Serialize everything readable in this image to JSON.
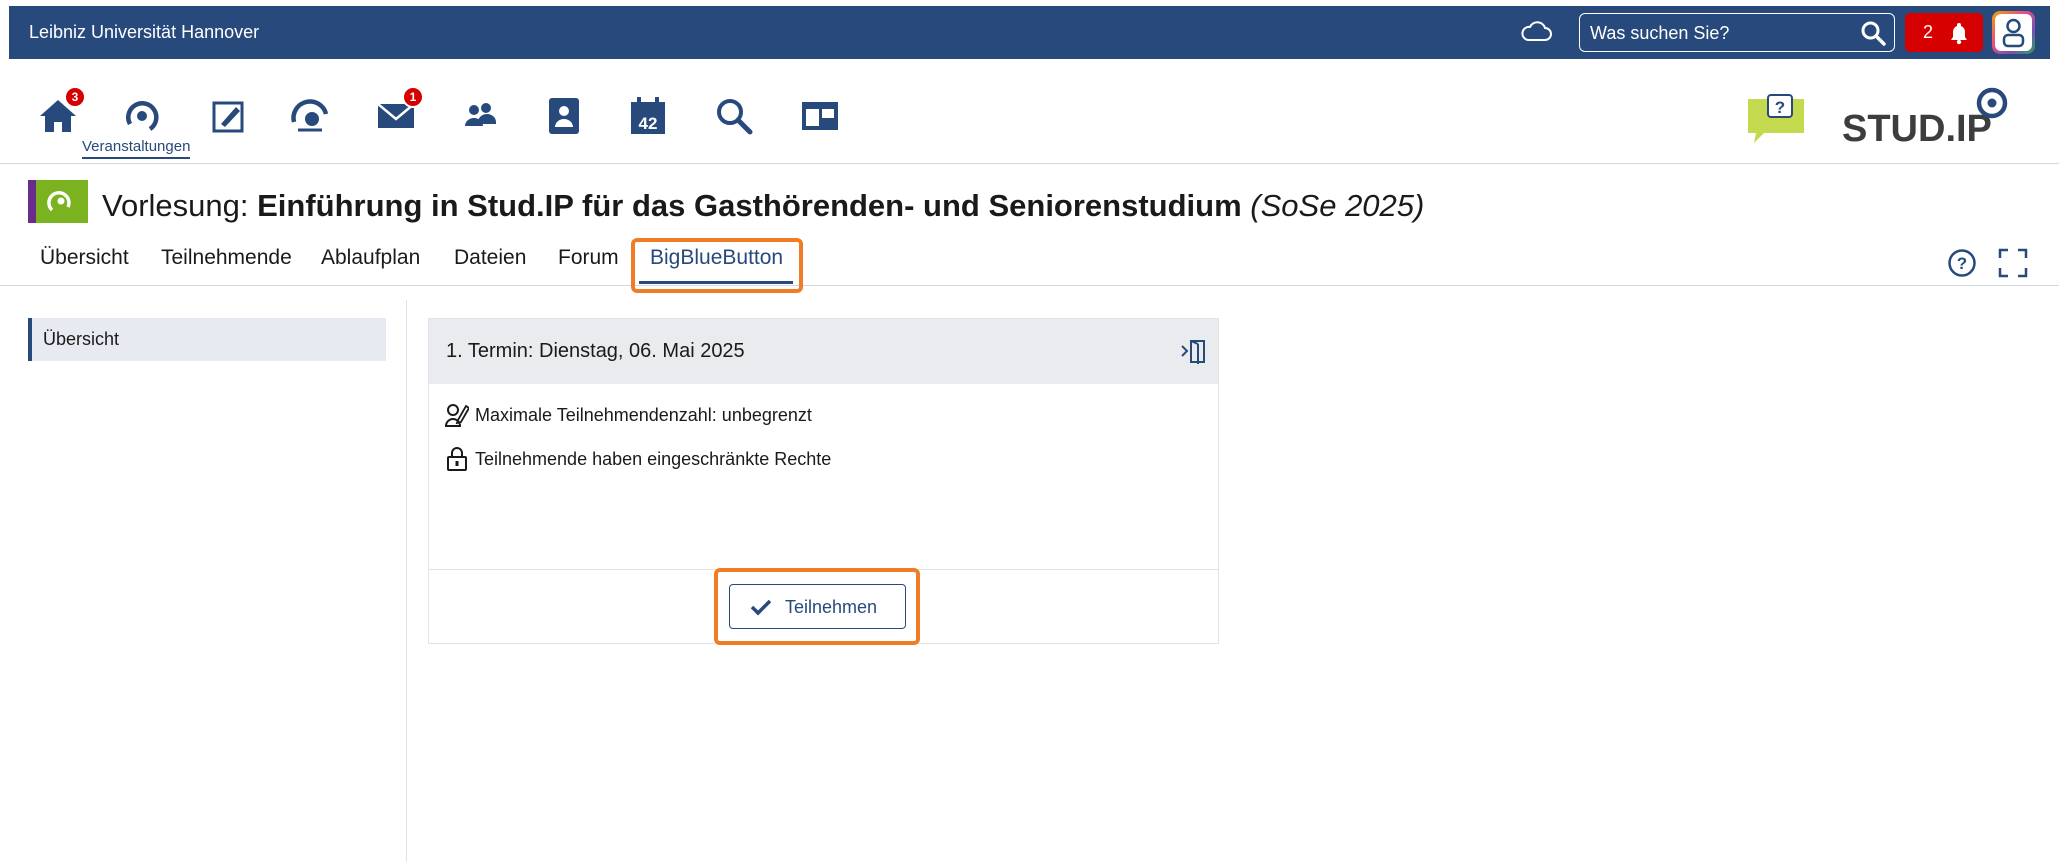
{
  "topbar": {
    "university": "Leibniz Universität Hannover",
    "search_placeholder": "Was suchen Sie?",
    "notification_count": "2"
  },
  "nav": {
    "home_badge": "3",
    "messages_badge": "1",
    "active_label": "Veranstaltungen",
    "calendar_day": "42",
    "logo_text": "STUD.IP"
  },
  "course": {
    "prefix": "Vorlesung: ",
    "name": "Einführung in Stud.IP für das Gasthörenden- und Seniorenstudium",
    "semester": "(SoSe 2025)"
  },
  "tabs": [
    {
      "label": "Übersicht"
    },
    {
      "label": "Teilnehmende"
    },
    {
      "label": "Ablaufplan"
    },
    {
      "label": "Dateien"
    },
    {
      "label": "Forum"
    },
    {
      "label": "BigBlueButton"
    }
  ],
  "sidebar": {
    "items": [
      {
        "label": "Übersicht"
      }
    ]
  },
  "meeting": {
    "title": "1. Termin: Dienstag, 06. Mai 2025",
    "max_participants": "Maximale Teilnehmendenzahl: unbegrenzt",
    "rights": "Teilnehmende haben eingeschränkte Rechte",
    "join_label": "Teilnehmen"
  },
  "colors": {
    "primary": "#28497c",
    "highlight": "#f07d25",
    "alert": "#d60000",
    "course_green": "#7bb21f"
  }
}
